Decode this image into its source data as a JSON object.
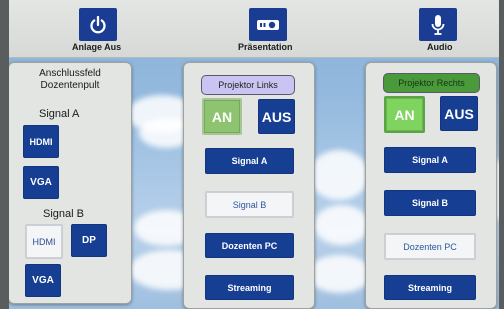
{
  "topbar": {
    "power_label": "Anlage Aus",
    "presentation_label": "Präsentation",
    "audio_label": "Audio"
  },
  "left_panel": {
    "title_line1": "Anschlussfeld",
    "title_line2": "Dozentenpult",
    "signal_a_label": "Signal A",
    "signal_a_hdmi": "HDMI",
    "signal_a_vga": "VGA",
    "signal_b_label": "Signal B",
    "signal_b_hdmi": "HDMI",
    "signal_b_dp": "DP",
    "signal_b_vga": "VGA"
  },
  "projector_left": {
    "title": "Projektor Links",
    "on_label": "AN",
    "off_label": "AUS",
    "signal_a": "Signal A",
    "signal_b": "Signal B",
    "dozenten_pc": "Dozenten PC",
    "streaming": "Streaming"
  },
  "projector_right": {
    "title": "Projektor Rechts",
    "on_label": "AN",
    "off_label": "AUS",
    "signal_a": "Signal A",
    "signal_b": "Signal B",
    "dozenten_pc": "Dozenten PC",
    "streaming": "Streaming"
  },
  "colors": {
    "button_blue": "#163f93",
    "on_green": "#7fd460",
    "header_left_bg": "#c9c4f2",
    "header_right_bg": "#4a9a3c"
  }
}
